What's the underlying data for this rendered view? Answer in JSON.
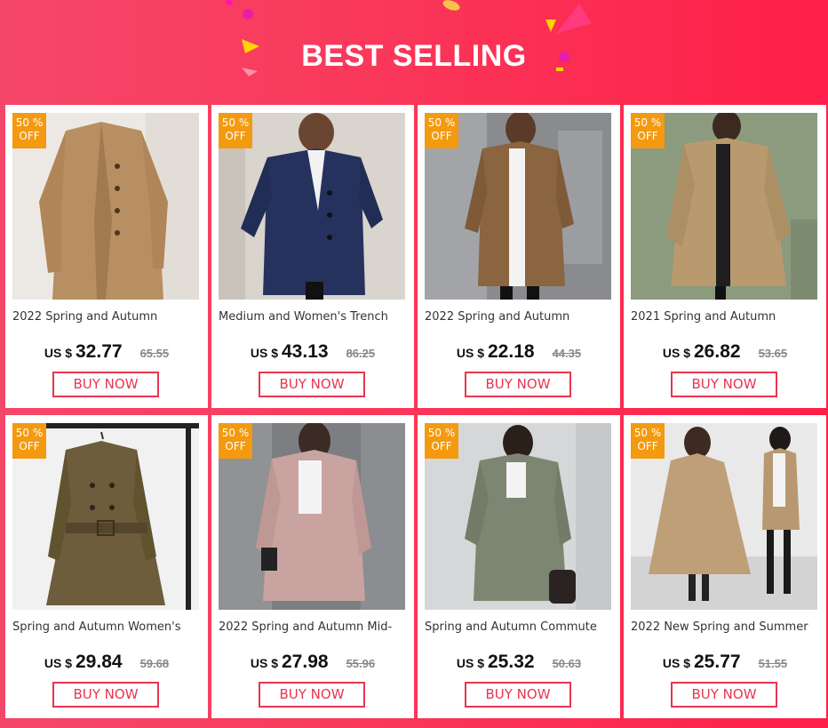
{
  "banner": {
    "title": "BEST SELLING"
  },
  "colors": {
    "accent": "#e8364f",
    "badge": "#f39a10",
    "background": "#f93a5c"
  },
  "products": [
    {
      "badge_line1": "50 %",
      "badge_line2": "OFF",
      "title": "2022 Spring and Autumn",
      "currency": "US $",
      "price": "32.77",
      "old_price": "65.55",
      "button": "BUY NOW",
      "image": "khaki trench coat"
    },
    {
      "badge_line1": "50 %",
      "badge_line2": "OFF",
      "title": "Medium and Women's Trench",
      "currency": "US $",
      "price": "43.13",
      "old_price": "86.25",
      "button": "BUY NOW",
      "image": "navy trench coat"
    },
    {
      "badge_line1": "50 %",
      "badge_line2": "OFF",
      "title": "2022 Spring and Autumn",
      "currency": "US $",
      "price": "22.18",
      "old_price": "44.35",
      "button": "BUY NOW",
      "image": "brown trench coat"
    },
    {
      "badge_line1": "50 %",
      "badge_line2": "OFF",
      "title": "2021 Spring and Autumn",
      "currency": "US $",
      "price": "26.82",
      "old_price": "53.65",
      "button": "BUY NOW",
      "image": "beige oversized coat"
    },
    {
      "badge_line1": "50 %",
      "badge_line2": "OFF",
      "title": "Spring and Autumn Women's",
      "currency": "US $",
      "price": "29.84",
      "old_price": "59.68",
      "button": "BUY NOW",
      "image": "olive belted trench coat"
    },
    {
      "badge_line1": "50 %",
      "badge_line2": "OFF",
      "title": "2022 Spring and Autumn Mid-",
      "currency": "US $",
      "price": "27.98",
      "old_price": "55.96",
      "button": "BUY NOW",
      "image": "pink hooded jacket"
    },
    {
      "badge_line1": "50 %",
      "badge_line2": "OFF",
      "title": "Spring and Autumn Commute",
      "currency": "US $",
      "price": "25.32",
      "old_price": "50.63",
      "button": "BUY NOW",
      "image": "grey-green hooded coat"
    },
    {
      "badge_line1": "50 %",
      "badge_line2": "OFF",
      "title": "2022 New Spring and Summer",
      "currency": "US $",
      "price": "25.77",
      "old_price": "51.55",
      "button": "BUY NOW",
      "image": "khaki flared trench coat"
    }
  ]
}
